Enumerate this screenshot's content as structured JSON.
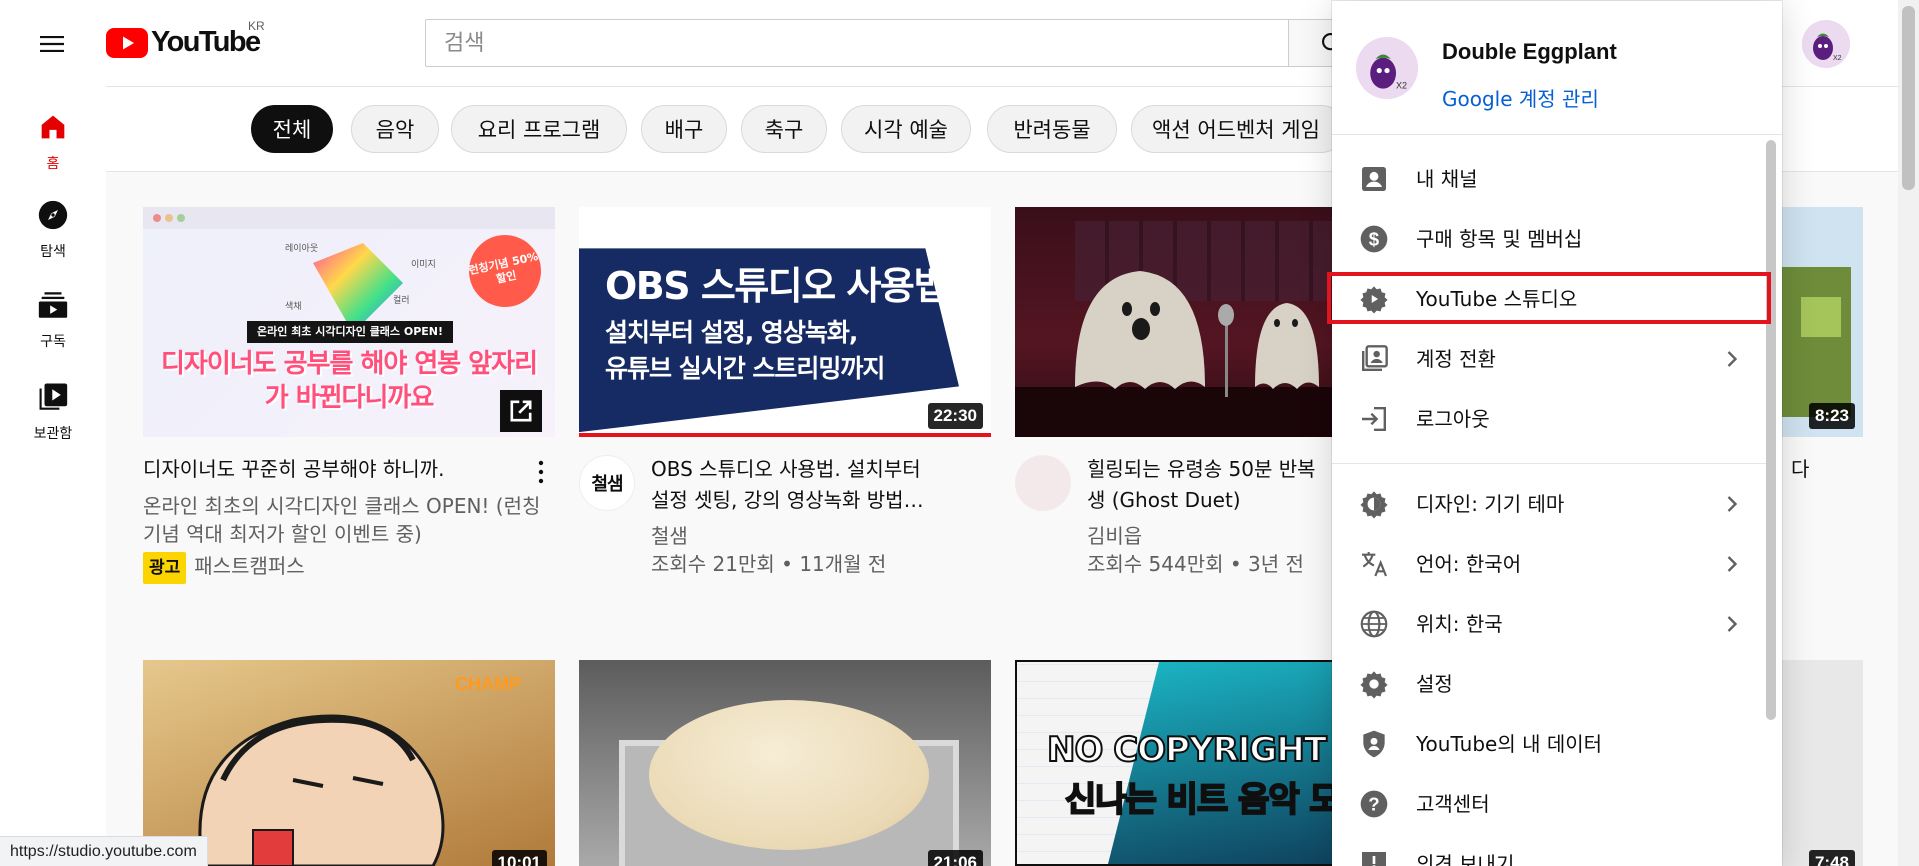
{
  "header": {
    "brand": "YouTube",
    "region": "KR",
    "search_placeholder": "검색"
  },
  "sidebar": {
    "items": [
      {
        "label": "홈",
        "icon": "home-icon",
        "active": true
      },
      {
        "label": "탐색",
        "icon": "explore-icon"
      },
      {
        "label": "구독",
        "icon": "subscriptions-icon"
      },
      {
        "label": "보관함",
        "icon": "library-icon"
      }
    ]
  },
  "chips": [
    "전체",
    "음악",
    "요리 프로그램",
    "배구",
    "축구",
    "시각 예술",
    "반려동물",
    "액션 어드벤처 게임"
  ],
  "videos": [
    {
      "thumb_text": "디자이너도 공부를 해야 연봉 앞자리가 바뀐다니까요",
      "thumb_banner": "온라인 최초 시각디자인 클래스 OPEN!",
      "thumb_badge": "런칭기념 50%할인",
      "thumb_labels": [
        "레이아웃",
        "이미지",
        "색채",
        "컬러"
      ],
      "title": "디자이너도 꾸준히 공부해야 하니까.",
      "description": "온라인 최초의 시각디자인 클래스 OPEN! (런칭 기념 역대 최저가 할인 이벤트 중)",
      "ad_label": "광고",
      "channel": "패스트캠퍼스"
    },
    {
      "thumb_line1": "OBS 스튜디오 사용법",
      "thumb_line2": "설치부터 설정, 영상녹화,",
      "thumb_line3": "유튜브 실시간 스트리밍까지",
      "duration": "22:30",
      "avatar_text": "철샘",
      "title_line1": "OBS 스튜디오 사용법. 설치부터",
      "title_line2": "설정 셋팅, 강의 영상녹화 방법…",
      "channel": "철샘",
      "meta": "조회수 21만회 • 11개월 전"
    },
    {
      "title_line1": "힐링되는 유령송 50분 반복",
      "title_line2": "생 (Ghost Duet)",
      "channel": "김비읍",
      "meta": "조회수 544만회 • 3년 전"
    },
    {
      "duration": "8:23",
      "title_partial": "다"
    },
    {
      "duration": "10:01",
      "thumb_logo": "CHAMP"
    },
    {
      "duration": "21:06"
    },
    {
      "thumb_line1": "NO COPYRIGHT MUS",
      "thumb_line2": "신나는 비트 음악 모"
    },
    {
      "duration": "7:48"
    }
  ],
  "account_menu": {
    "user_name": "Double Eggplant",
    "manage_link": "Google 계정 관리",
    "avatar_text": "X2",
    "items": [
      {
        "label": "내 채널",
        "icon": "account-box-icon"
      },
      {
        "label": "구매 항목 및 멤버십",
        "icon": "dollar-circle-icon"
      },
      {
        "label": "YouTube 스튜디오",
        "icon": "studio-gear-icon",
        "highlighted": true
      },
      {
        "label": "계정 전환",
        "icon": "switch-account-icon",
        "chevron": true
      },
      {
        "label": "로그아웃",
        "icon": "logout-icon"
      },
      {
        "label": "디자인: 기기 테마",
        "icon": "theme-icon",
        "chevron": true
      },
      {
        "label": "언어: 한국어",
        "icon": "translate-icon",
        "chevron": true
      },
      {
        "label": "위치: 한국",
        "icon": "globe-icon",
        "chevron": true
      },
      {
        "label": "설정",
        "icon": "settings-icon"
      },
      {
        "label": "YouTube의 내 데이터",
        "icon": "shield-person-icon"
      },
      {
        "label": "고객센터",
        "icon": "help-icon"
      },
      {
        "label": "의견 보내기",
        "icon": "feedback-icon"
      }
    ]
  },
  "status_bar": {
    "url": "https://studio.youtube.com"
  },
  "colors": {
    "brand_red": "#ff0000",
    "active_red": "#e40000",
    "link_blue": "#065fd4",
    "highlight_red": "#e4141e",
    "ad_yellow": "#fcd400"
  }
}
